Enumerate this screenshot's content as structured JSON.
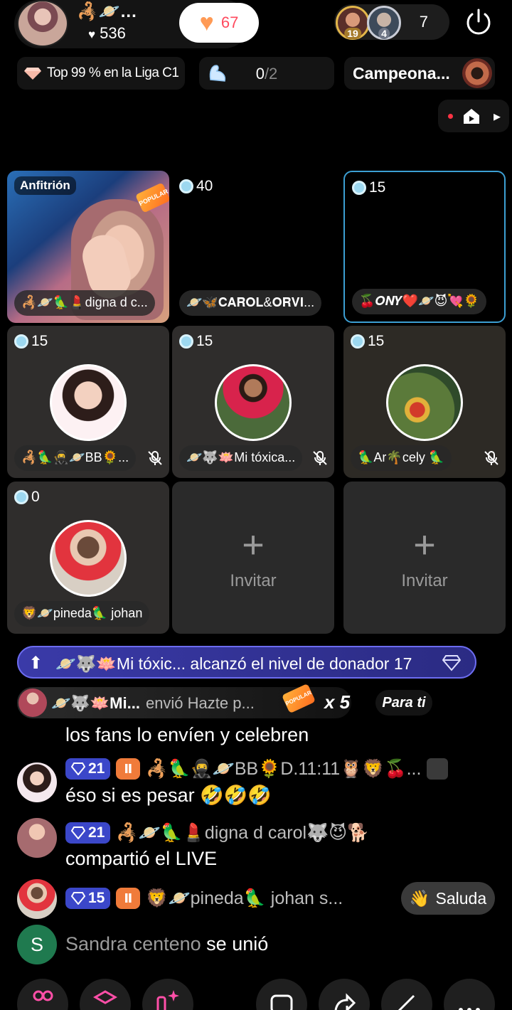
{
  "host": {
    "name": "🦂🪐...",
    "likes_icon": "heart-icon",
    "likes": "536",
    "like_count": "67"
  },
  "viewers": {
    "avatar_1_level": "19",
    "avatar_2_level": "4",
    "count": "7"
  },
  "badges": {
    "league": "Top 99 % en la Liga C1",
    "task_done": "0",
    "task_total": "/2",
    "championship": "Campeona..."
  },
  "grid": {
    "host_tag": "Anfitrión",
    "popular_label": "POPULAR",
    "host_name": "🦂🪐🦜💄digna d c...",
    "slots": [
      {
        "score": "40",
        "name": "🪐🦋𝐂𝐀𝐑𝐎𝐋&𝐎𝐑𝐕𝐈..."
      },
      {
        "score": "15",
        "name": "🍒𝑶𝑵𝒀❤️🪐😈💘🌻"
      },
      {
        "score": "15",
        "name": "🦂🦜🥷🪐BB🌻..."
      },
      {
        "score": "15",
        "name": "🪐🐺🪷Mi tóxica..."
      },
      {
        "score": "15",
        "name": "🦜Ar🌴cely 🦜"
      },
      {
        "score": "0",
        "name": "🦁🪐pineda🦜 johan"
      }
    ],
    "invite_label": "Invitar"
  },
  "level_banner": {
    "text": "🪐🐺🪷Mi tóxic... alcanzó el nivel de donador 17"
  },
  "gift_banner": {
    "sender": "🪐🐺🪷Mi...",
    "sent_text": "envió Hazte p...",
    "multiplier": "x 5",
    "popular_label": "POPULAR"
  },
  "para_ti": "Para ti",
  "chat": {
    "line_0": "los fans lo envíen y celebren",
    "msg_1": {
      "level": "21",
      "fan": "Ⅱ",
      "user": "🦂🦜🥷🪐BB🌻D.11:11🦉🦁🍒...",
      "text": "éso si es pesar 🤣🤣🤣"
    },
    "msg_2": {
      "level": "21",
      "user": "🦂🪐🦜💄digna d carol🐺😈🐕",
      "text": "compartió el LIVE"
    },
    "msg_3": {
      "level": "15",
      "fan": "Ⅱ",
      "user": "🦁🪐pineda🦜 johan s..."
    },
    "saluda_label": "Saluda",
    "join": {
      "initial": "S",
      "name": "Sandra centeno",
      "action": "se unió"
    }
  },
  "colors": {
    "accent_blue": "#3b47c9",
    "like_red": "#ff4a5e",
    "join_green": "#1f7a4f"
  }
}
